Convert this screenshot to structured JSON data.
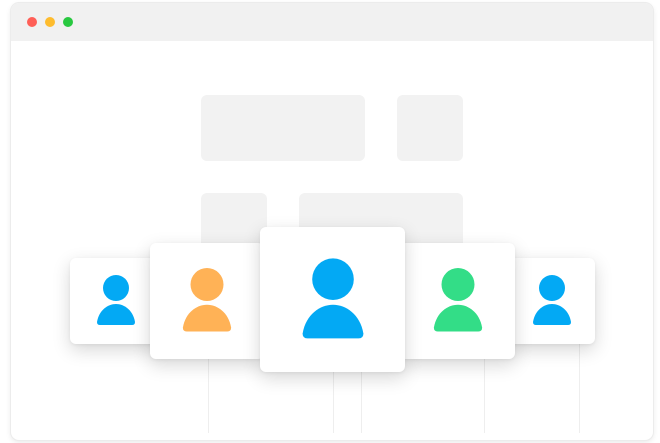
{
  "window": {
    "controls": [
      {
        "name": "close",
        "color": "#ff5f57"
      },
      {
        "name": "minimize",
        "color": "#febc2e"
      },
      {
        "name": "maximize",
        "color": "#28c840"
      }
    ]
  },
  "cards": [
    {
      "icon": "user-icon",
      "color": "#03a9f4"
    },
    {
      "icon": "user-icon",
      "color": "#ffb256"
    },
    {
      "icon": "user-icon",
      "color": "#03a9f4"
    },
    {
      "icon": "user-icon",
      "color": "#33dd87"
    },
    {
      "icon": "user-icon",
      "color": "#03a9f4"
    }
  ]
}
